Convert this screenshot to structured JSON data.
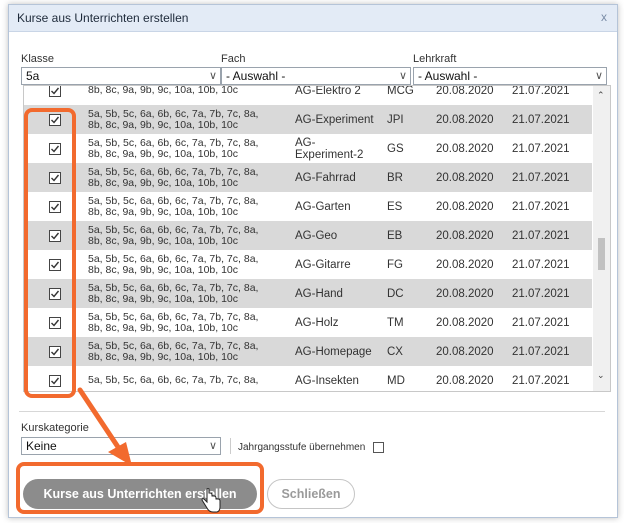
{
  "dialog": {
    "title": "Kurse aus Unterrichten erstellen",
    "close_glyph": "x"
  },
  "filters": {
    "klasse_label": "Klasse",
    "klasse_value": "5a",
    "fach_label": "Fach",
    "fach_value": "- Auswahl -",
    "lehrkraft_label": "Lehrkraft",
    "lehrkraft_value": "- Auswahl -"
  },
  "rows": [
    {
      "classes_1": "",
      "classes_2": "8b, 8c, 9a, 9b, 9c, 10a, 10b, 10c",
      "course": "AG-Elektro 2",
      "teacher": "MCG",
      "start": "20.08.2020",
      "end": "21.07.2021",
      "checked": true
    },
    {
      "classes_1": "5a, 5b, 5c, 6a, 6b, 6c, 7a, 7b, 7c, 8a,",
      "classes_2": "8b, 8c, 9a, 9b, 9c, 10a, 10b, 10c",
      "course": "AG-Experiment",
      "teacher": "JPI",
      "start": "20.08.2020",
      "end": "21.07.2021",
      "checked": true
    },
    {
      "classes_1": "5a, 5b, 5c, 6a, 6b, 6c, 7a, 7b, 7c, 8a,",
      "classes_2": "8b, 8c, 9a, 9b, 9c, 10a, 10b, 10c",
      "course": "AG- Experiment-2",
      "teacher": "GS",
      "start": "20.08.2020",
      "end": "21.07.2021",
      "checked": true
    },
    {
      "classes_1": "5a, 5b, 5c, 6a, 6b, 6c, 7a, 7b, 7c, 8a,",
      "classes_2": "8b, 8c, 9a, 9b, 9c, 10a, 10b, 10c",
      "course": "AG-Fahrrad",
      "teacher": "BR",
      "start": "20.08.2020",
      "end": "21.07.2021",
      "checked": true
    },
    {
      "classes_1": "5a, 5b, 5c, 6a, 6b, 6c, 7a, 7b, 7c, 8a,",
      "classes_2": "8b, 8c, 9a, 9b, 9c, 10a, 10b, 10c",
      "course": "AG-Garten",
      "teacher": "ES",
      "start": "20.08.2020",
      "end": "21.07.2021",
      "checked": true
    },
    {
      "classes_1": "5a, 5b, 5c, 6a, 6b, 6c, 7a, 7b, 7c, 8a,",
      "classes_2": "8b, 8c, 9a, 9b, 9c, 10a, 10b, 10c",
      "course": "AG-Geo",
      "teacher": "EB",
      "start": "20.08.2020",
      "end": "21.07.2021",
      "checked": true
    },
    {
      "classes_1": "5a, 5b, 5c, 6a, 6b, 6c, 7a, 7b, 7c, 8a,",
      "classes_2": "8b, 8c, 9a, 9b, 9c, 10a, 10b, 10c",
      "course": "AG-Gitarre",
      "teacher": "FG",
      "start": "20.08.2020",
      "end": "21.07.2021",
      "checked": true
    },
    {
      "classes_1": "5a, 5b, 5c, 6a, 6b, 6c, 7a, 7b, 7c, 8a,",
      "classes_2": "8b, 8c, 9a, 9b, 9c, 10a, 10b, 10c",
      "course": "AG-Hand",
      "teacher": "DC",
      "start": "20.08.2020",
      "end": "21.07.2021",
      "checked": true
    },
    {
      "classes_1": "5a, 5b, 5c, 6a, 6b, 6c, 7a, 7b, 7c, 8a,",
      "classes_2": "8b, 8c, 9a, 9b, 9c, 10a, 10b, 10c",
      "course": "AG-Holz",
      "teacher": "TM",
      "start": "20.08.2020",
      "end": "21.07.2021",
      "checked": true
    },
    {
      "classes_1": "5a, 5b, 5c, 6a, 6b, 6c, 7a, 7b, 7c, 8a,",
      "classes_2": "8b, 8c, 9a, 9b, 9c, 10a, 10b, 10c",
      "course": "AG-Homepage",
      "teacher": "CX",
      "start": "20.08.2020",
      "end": "21.07.2021",
      "checked": true
    },
    {
      "classes_1": "5a, 5b, 5c, 6a, 6b, 6c, 7a, 7b, 7c, 8a,",
      "classes_2": "",
      "course": "AG-Insekten",
      "teacher": "MD",
      "start": "20.08.2020",
      "end": "21.07.2021",
      "checked": true
    }
  ],
  "bottom": {
    "kurskategorie_label": "Kurskategorie",
    "kurskategorie_value": "Keine",
    "jahrgang_label": "Jahrgangsstufe übernehmen",
    "create_button": "Kurse aus Unterrichten erstellen",
    "close_button": "Schließen"
  },
  "icons": {
    "checkmark": "checkmark-icon",
    "dropdown": "chevron-down-icon",
    "scroll_up": "scroll-up-icon",
    "scroll_down": "scroll-down-icon",
    "cursor": "hand-pointer-icon"
  },
  "colors": {
    "highlight": "#f26a2e",
    "titlebar": "#e3ebf6",
    "row_alt": "#d9d9d9",
    "primary_button": "#8c8c8c"
  }
}
